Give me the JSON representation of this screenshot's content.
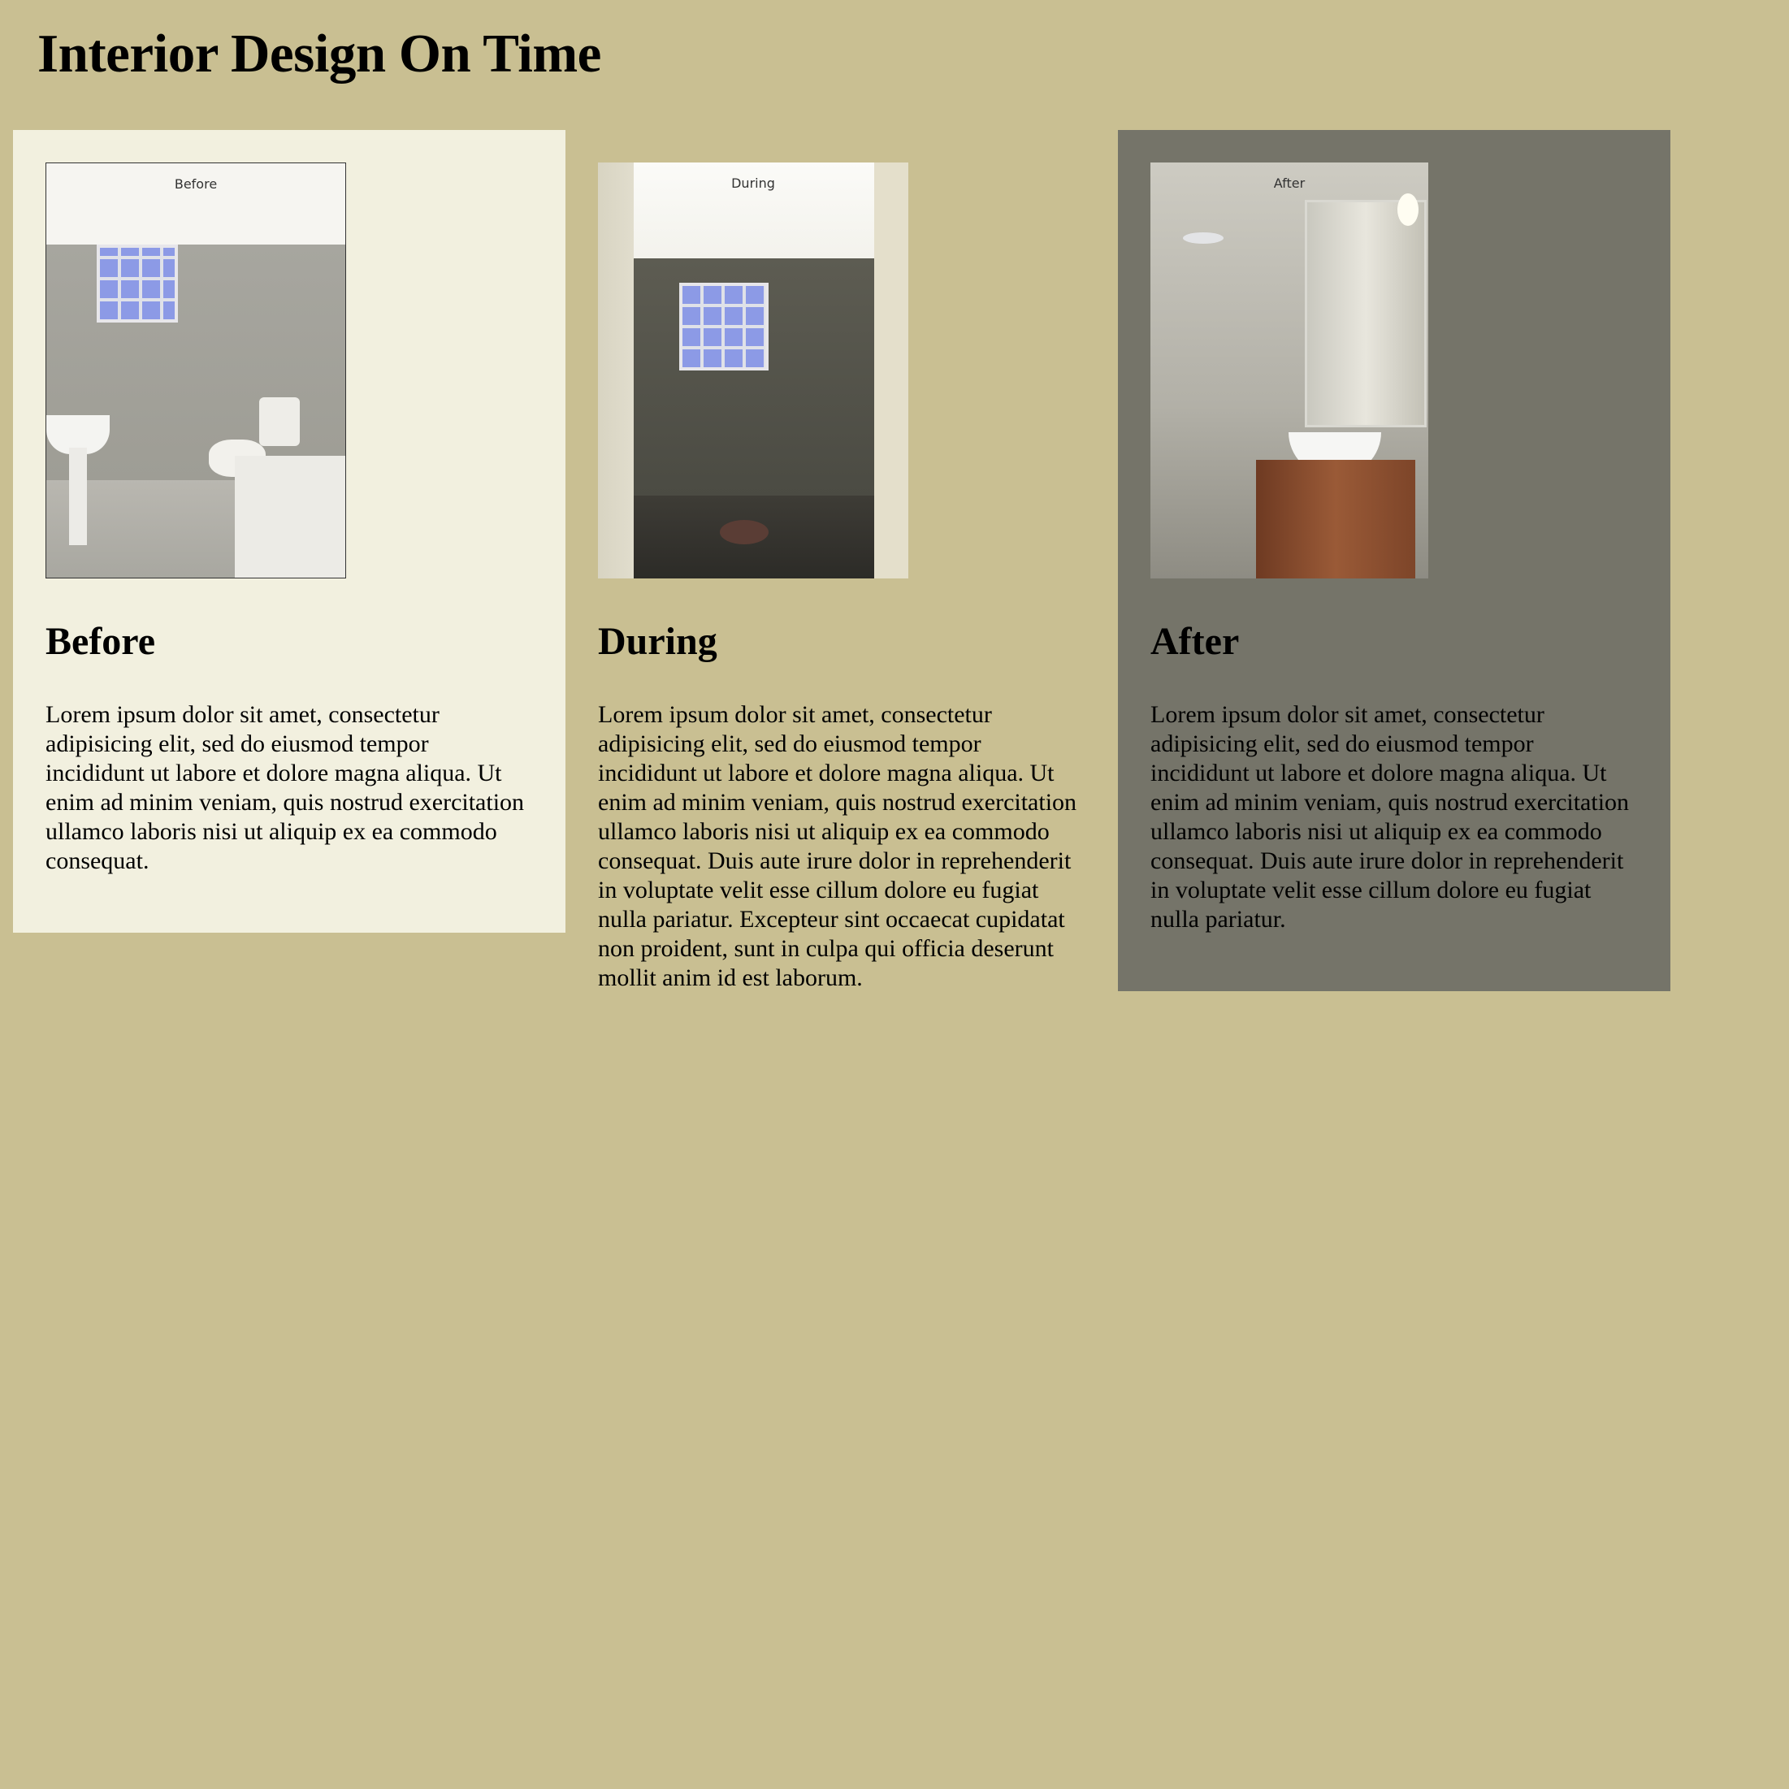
{
  "site": {
    "title": "Interior Design On Time"
  },
  "cards": [
    {
      "heading": "Before",
      "image_caption": "Before",
      "body": "Lorem ipsum dolor sit amet, consectetur adipisicing elit, sed do eiusmod tempor incididunt ut labore et dolore magna aliqua. Ut enim ad minim veniam, quis nostrud exercitation ullamco laboris nisi ut aliquip ex ea commodo consequat."
    },
    {
      "heading": "During",
      "image_caption": "During",
      "body": "Lorem ipsum dolor sit amet, consectetur adipisicing elit, sed do eiusmod tempor incididunt ut labore et dolore magna aliqua. Ut enim ad minim veniam, quis nostrud exercitation ullamco laboris nisi ut aliquip ex ea commodo consequat. Duis aute irure dolor in reprehenderit in voluptate velit esse cillum dolore eu fugiat nulla pariatur. Excepteur sint occaecat cupidatat non proident, sunt in culpa qui officia deserunt mollit anim id est laborum."
    },
    {
      "heading": "After",
      "image_caption": "After",
      "body": "Lorem ipsum dolor sit amet, consectetur adipisicing elit, sed do eiusmod tempor incididunt ut labore et dolore magna aliqua. Ut enim ad minim veniam, quis nostrud exercitation ullamco laboris nisi ut aliquip ex ea commodo consequat. Duis aute irure dolor in reprehenderit in voluptate velit esse cillum dolore eu fugiat nulla pariatur."
    }
  ],
  "colors": {
    "page_background": "#c9bf92",
    "before_card": "#f2f0df",
    "after_card": "#757469"
  }
}
